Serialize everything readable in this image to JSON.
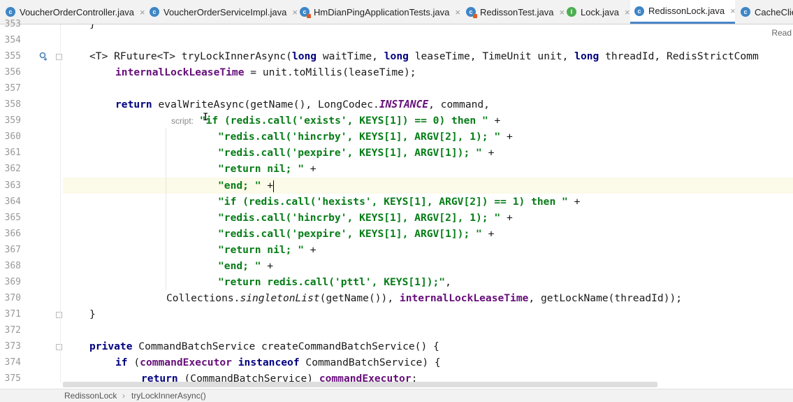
{
  "tabs": [
    {
      "name": "VoucherOrderController.java",
      "icon": "c"
    },
    {
      "name": "VoucherOrderServiceImpl.java",
      "icon": "c"
    },
    {
      "name": "HmDianPingApplicationTests.java",
      "icon": "t"
    },
    {
      "name": "RedissonTest.java",
      "icon": "t"
    },
    {
      "name": "Lock.java",
      "icon": "i"
    },
    {
      "name": "RedissonLock.java",
      "icon": "c",
      "active": true
    },
    {
      "name": "CacheClien",
      "icon": "c"
    }
  ],
  "close_glyph": "×",
  "reader_mode": "Read",
  "line_numbers": [
    "353",
    "354",
    "355",
    "356",
    "357",
    "358",
    "359",
    "360",
    "361",
    "362",
    "363",
    "364",
    "365",
    "366",
    "367",
    "368",
    "369",
    "370",
    "371",
    "372",
    "373",
    "374",
    "375"
  ],
  "code": {
    "l353": "}",
    "l355": {
      "a": "<T> RFuture<T> tryLockInnerAsync(",
      "k1": "long",
      "b": " waitTime, ",
      "k2": "long",
      "c": " leaseTime, TimeUnit unit, ",
      "k3": "long",
      "d": " threadId, RedisStrictComm"
    },
    "l356": {
      "f": "internalLockLeaseTime",
      "b": " = unit.toMillis(leaseTime);"
    },
    "l358": {
      "k": "return",
      "a": " evalWriteAsync(getName(), LongCodec.",
      "i": "INSTANCE",
      "b": ", command,"
    },
    "l359": {
      "hint": "script:",
      "s": " \"if (redis.call('exists', KEYS[1]) == 0) then \"",
      "p": " +"
    },
    "l360": {
      "s": "\"redis.call('hincrby', KEYS[1], ARGV[2], 1); \"",
      "p": " +"
    },
    "l361": {
      "s": "\"redis.call('pexpire', KEYS[1], ARGV[1]); \"",
      "p": " +"
    },
    "l362": {
      "s": "\"return nil; \"",
      "p": " +"
    },
    "l363": {
      "s": "\"end; \"",
      "p": " +"
    },
    "l364": {
      "s": "\"if (redis.call('hexists', KEYS[1], ARGV[2]) == 1) then \"",
      "p": " +"
    },
    "l365": {
      "s": "\"redis.call('hincrby', KEYS[1], ARGV[2], 1); \"",
      "p": " +"
    },
    "l366": {
      "s": "\"redis.call('pexpire', KEYS[1], ARGV[1]); \"",
      "p": " +"
    },
    "l367": {
      "s": "\"return nil; \"",
      "p": " +"
    },
    "l368": {
      "s": "\"end; \"",
      "p": " +"
    },
    "l369": {
      "s": "\"return redis.call('pttl', KEYS[1]);\"",
      "p": ","
    },
    "l370": {
      "a": "Collections.",
      "i": "singletonList",
      "b": "(getName()), ",
      "f": "internalLockLeaseTime",
      "c": ", getLockName(threadId));"
    },
    "l371": "}",
    "l373": {
      "k": "private",
      "a": " CommandBatchService createCommandBatchService() {"
    },
    "l374": {
      "k": "if",
      "a": " (",
      "f": "commandExecutor",
      "sp": " ",
      "k2": "instanceof",
      "b": " CommandBatchService) {"
    },
    "l375": {
      "k": "return",
      "a": " (CommandBatchService) ",
      "f": "commandExecutor",
      "b": ";"
    }
  },
  "breadcrumb": {
    "class": "RedissonLock",
    "sep": "›",
    "method": "tryLockInnerAsync()"
  },
  "colors": {
    "keyword": "#000080",
    "string": "#067d17",
    "field": "#660e7a",
    "active_tab_underline": "#4a86c8"
  }
}
